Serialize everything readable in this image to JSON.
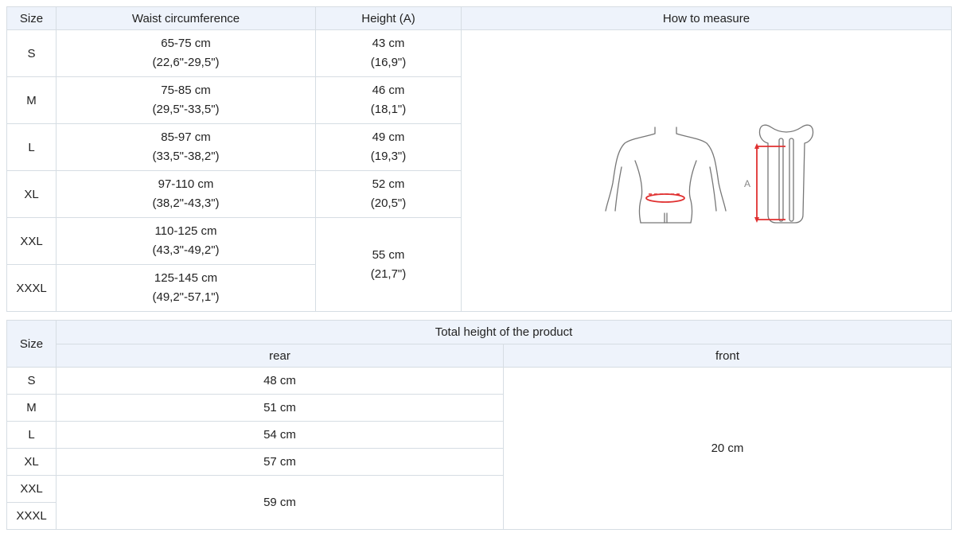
{
  "table1": {
    "headers": {
      "size": "Size",
      "waist": "Waist circumference",
      "height": "Height (A)",
      "measure": "How to measure"
    },
    "rows": [
      {
        "size": "S",
        "waist_cm": "65-75 cm",
        "waist_in": "(22,6\"-29,5\")",
        "height_cm": "43 cm",
        "height_in": "(16,9\")"
      },
      {
        "size": "M",
        "waist_cm": "75-85 cm",
        "waist_in": "(29,5\"-33,5\")",
        "height_cm": "46 cm",
        "height_in": "(18,1\")"
      },
      {
        "size": "L",
        "waist_cm": "85-97 cm",
        "waist_in": "(33,5\"-38,2\")",
        "height_cm": "49 cm",
        "height_in": "(19,3\")"
      },
      {
        "size": "XL",
        "waist_cm": "97-110 cm",
        "waist_in": "(38,2\"-43,3\")",
        "height_cm": "52 cm",
        "height_in": "(20,5\")"
      },
      {
        "size": "XXL",
        "waist_cm": "110-125 cm",
        "waist_in": "(43,3\"-49,2\")"
      },
      {
        "size": "XXXL",
        "waist_cm": "125-145 cm",
        "waist_in": "(49,2\"-57,1\")"
      }
    ],
    "merged_height": {
      "cm": "55 cm",
      "in": "(21,7\")"
    },
    "diagram_label": "A"
  },
  "table2": {
    "headers": {
      "size": "Size",
      "total": "Total height of the product",
      "rear": "rear",
      "front": "front"
    },
    "rows": [
      {
        "size": "S",
        "rear": "48 cm"
      },
      {
        "size": "M",
        "rear": "51 cm"
      },
      {
        "size": "L",
        "rear": "54 cm"
      },
      {
        "size": "XL",
        "rear": "57 cm"
      },
      {
        "size": "XXL"
      },
      {
        "size": "XXXL"
      }
    ],
    "merged_rear": "59 cm",
    "front_value": "20 cm"
  },
  "colors": {
    "header_bg": "#eef3fb",
    "border": "#d6dde3",
    "accent_red": "#e03030",
    "outline": "#777777"
  }
}
